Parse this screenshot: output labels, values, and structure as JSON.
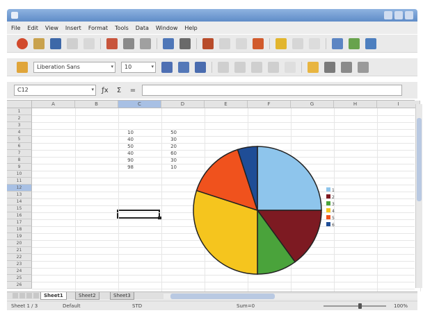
{
  "menubar": {
    "items": [
      "File",
      "Edit",
      "View",
      "Insert",
      "Format",
      "Tools",
      "Data",
      "Window",
      "Help"
    ]
  },
  "toolbar2": {
    "font_name": "Liberation Sans",
    "font_size": "10"
  },
  "formula": {
    "cell_ref": "C12",
    "content": ""
  },
  "columns": [
    "A",
    "B",
    "C",
    "D",
    "E",
    "F",
    "G",
    "H",
    "I"
  ],
  "selected_column": "C",
  "rows": [
    "1",
    "2",
    "3",
    "4",
    "5",
    "6",
    "7",
    "8",
    "9",
    "10",
    "11",
    "12",
    "13",
    "14",
    "15",
    "16",
    "17",
    "18",
    "19",
    "20",
    "21",
    "22",
    "23",
    "24",
    "25",
    "26"
  ],
  "selected_row": "12",
  "cells": {
    "C": [
      "10",
      "40",
      "50",
      "40",
      "90",
      "98"
    ],
    "D": [
      "50",
      "30",
      "20",
      "60",
      "30",
      "10"
    ]
  },
  "chart_data": {
    "type": "pie",
    "categories": [
      "1",
      "2",
      "3",
      "4",
      "5",
      "6"
    ],
    "values": [
      50,
      30,
      20,
      60,
      30,
      10
    ],
    "colors": [
      "#8ec5ec",
      "#7d1a22",
      "#4aa33b",
      "#f5c51e",
      "#f0521d",
      "#1f4d96"
    ],
    "legend_position": "right"
  },
  "sheet_tabs": [
    "Sheet1",
    "Sheet2",
    "Sheet3"
  ],
  "active_sheet": "Sheet1",
  "statusbar": {
    "sheet": "Sheet 1 / 3",
    "style": "Default",
    "mode": "STD",
    "summary": "Sum=0",
    "zoom": "100%"
  },
  "colors": {
    "title_bar": "#6f98d0",
    "selection_header": "#a8c0e4"
  }
}
